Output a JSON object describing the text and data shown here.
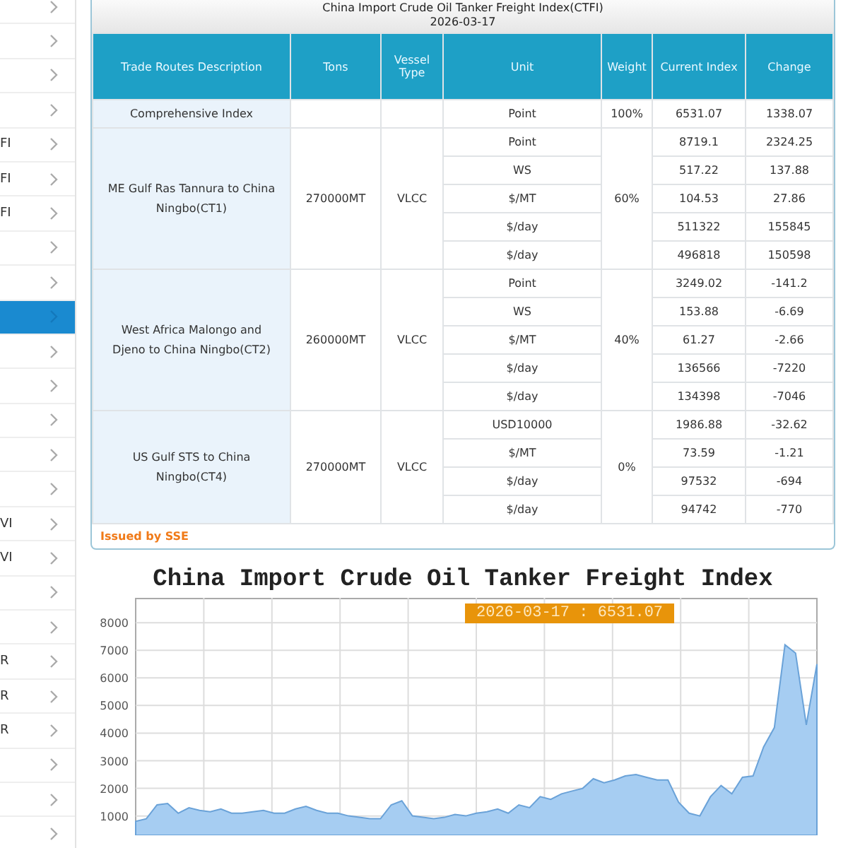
{
  "sidebar": {
    "items": [
      {
        "selected": false
      },
      {
        "selected": false
      },
      {
        "selected": false
      },
      {
        "selected": false
      },
      {
        "text": "FI",
        "selected": false
      },
      {
        "text": "FI",
        "selected": false
      },
      {
        "text": "FI",
        "selected": false
      },
      {
        "selected": false
      },
      {
        "selected": false
      },
      {
        "selected": true
      },
      {
        "selected": false
      },
      {
        "selected": false
      },
      {
        "selected": false
      },
      {
        "selected": false
      },
      {
        "selected": false
      },
      {
        "text": "VI",
        "selected": false
      },
      {
        "text": "VI",
        "selected": false
      },
      {
        "selected": false
      },
      {
        "selected": false
      },
      {
        "text": "R",
        "selected": false
      },
      {
        "text": "R",
        "selected": false
      },
      {
        "text": "R",
        "selected": false
      },
      {
        "selected": false
      },
      {
        "selected": false
      },
      {
        "selected": false
      }
    ]
  },
  "index_table": {
    "title": "China Import Crude Oil Tanker Freight Index(CTFI)",
    "date": "2026-03-17",
    "columns": [
      "Trade Routes Description",
      "Tons",
      "Vessel Type",
      "Unit",
      "Weight",
      "Current Index",
      "Change"
    ],
    "comprehensive": {
      "description": "Comprehensive Index",
      "unit": "Point",
      "weight": "100%",
      "current_index": "6531.07",
      "change": "1338.07"
    },
    "routes": [
      {
        "description": "ME Gulf Ras Tannura to China Ningbo(CT1)",
        "tons": "270000MT",
        "vessel_type": "VLCC",
        "weight": "60%",
        "rows": [
          {
            "unit": "Point",
            "current_index": "8719.1",
            "change": "2324.25"
          },
          {
            "unit": "WS",
            "current_index": "517.22",
            "change": "137.88"
          },
          {
            "unit": "$/MT",
            "current_index": "104.53",
            "change": "27.86"
          },
          {
            "unit": "$/day",
            "current_index": "511322",
            "change": "155845"
          },
          {
            "unit": "$/day",
            "current_index": "496818",
            "change": "150598"
          }
        ]
      },
      {
        "description": "West Africa Malongo and Djeno to China Ningbo(CT2)",
        "tons": "260000MT",
        "vessel_type": "VLCC",
        "weight": "40%",
        "rows": [
          {
            "unit": "Point",
            "current_index": "3249.02",
            "change": "-141.2"
          },
          {
            "unit": "WS",
            "current_index": "153.88",
            "change": "-6.69"
          },
          {
            "unit": "$/MT",
            "current_index": "61.27",
            "change": "-2.66"
          },
          {
            "unit": "$/day",
            "current_index": "136566",
            "change": "-7220"
          },
          {
            "unit": "$/day",
            "current_index": "134398",
            "change": "-7046"
          }
        ]
      },
      {
        "description": "US Gulf STS to China Ningbo(CT4)",
        "tons": "270000MT",
        "vessel_type": "VLCC",
        "weight": "0%",
        "rows": [
          {
            "unit": "USD10000",
            "current_index": "1986.88",
            "change": "-32.62"
          },
          {
            "unit": "$/MT",
            "current_index": "73.59",
            "change": "-1.21"
          },
          {
            "unit": "$/day",
            "current_index": "97532",
            "change": "-694"
          },
          {
            "unit": "$/day",
            "current_index": "94742",
            "change": "-770"
          }
        ]
      }
    ],
    "footer": "Issued by SSE"
  },
  "chart": {
    "tooltip": "2026-03-17 : 6531.07",
    "chart_data": {
      "type": "area",
      "title": "China Import Crude Oil Tanker Freight Index",
      "grid": true,
      "ylim": [
        300,
        8900
      ],
      "yticks": [
        1000,
        2000,
        3000,
        4000,
        5000,
        6000,
        7000,
        8000
      ],
      "series": [
        {
          "color": "#a6cdf2",
          "values": [
            800,
            900,
            1400,
            1450,
            1100,
            1300,
            1200,
            1150,
            1250,
            1100,
            1100,
            1150,
            1200,
            1100,
            1100,
            1250,
            1350,
            1200,
            1100,
            1100,
            1000,
            950,
            900,
            900,
            1400,
            1550,
            1000,
            950,
            900,
            950,
            1050,
            1000,
            1100,
            1150,
            1250,
            1100,
            1400,
            1300,
            1700,
            1600,
            1800,
            1900,
            2000,
            2350,
            2200,
            2300,
            2450,
            2500,
            2400,
            2300,
            2300,
            1500,
            1100,
            1000,
            1700,
            2100,
            1800,
            2400,
            2450,
            3500,
            4200,
            7200,
            6900,
            4300,
            6500
          ]
        }
      ]
    }
  }
}
